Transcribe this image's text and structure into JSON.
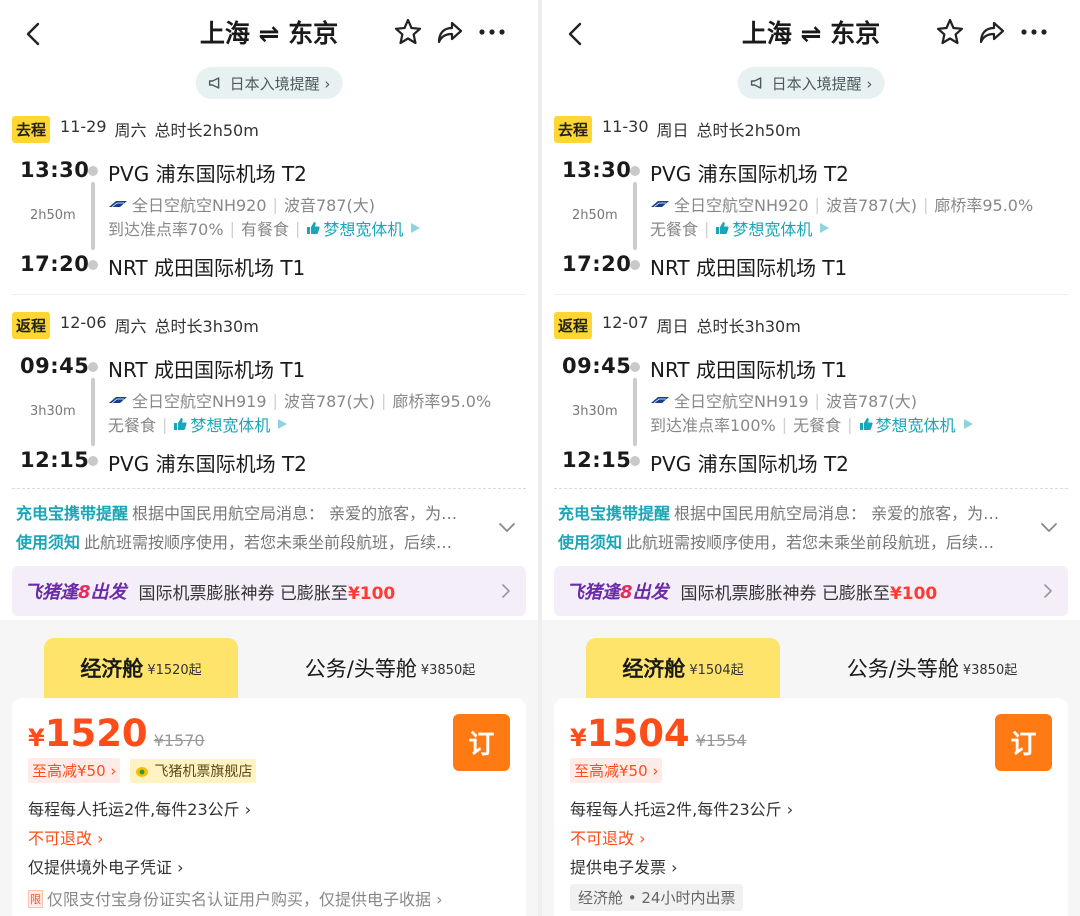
{
  "panels": [
    {
      "header": {
        "title": "上海 ⇌ 东京"
      },
      "notice": "日本入境提醒 ›",
      "outbound": {
        "badge": "去程",
        "date": "11-29",
        "weekday": "周六",
        "total": "总时长2h50m",
        "dep_time": "13:30",
        "dep_airport": "PVG 浦东国际机场 T2",
        "arr_time": "17:20",
        "arr_airport": "NRT 成田国际机场 T1",
        "duration": "2h50m",
        "airline": "全日空航空NH920",
        "aircraft": "波音787(大)",
        "extra1": "",
        "ontime": "到达准点率70%",
        "meal": "有餐食",
        "dream": "梦想宽体机"
      },
      "return": {
        "badge": "返程",
        "date": "12-06",
        "weekday": "周六",
        "total": "总时长3h30m",
        "dep_time": "09:45",
        "dep_airport": "NRT 成田国际机场 T1",
        "arr_time": "12:15",
        "arr_airport": "PVG 浦东国际机场 T2",
        "duration": "3h30m",
        "airline": "全日空航空NH919",
        "aircraft": "波音787(大)",
        "extra1": "廊桥率95.0%",
        "ontime": "",
        "meal": "无餐食",
        "dream": "梦想宽体机"
      },
      "reminders": {
        "r1_title": "充电宝携带提醒",
        "r1_text": "根据中国民用航空局消息： 亲爱的旅客，为…",
        "r2_title": "使用须知",
        "r2_text": "此航班需按顺序使用，若您未乘坐前段航班，后续…"
      },
      "promo": {
        "brand_a": "飞猪逢",
        "brand_b": "8",
        "brand_c": "出发",
        "text": "国际机票膨胀神券 已膨胀至",
        "amount": "¥100"
      },
      "tabs": {
        "econ_name": "经济舱",
        "econ_price": "¥1520起",
        "biz_name": "公务/头等舱",
        "biz_price": "¥3850起"
      },
      "fare": {
        "yen": "¥",
        "price": "1520",
        "orig": "¥1570",
        "book": "订",
        "discount": "至高减¥50 ›",
        "shop": "飞猪机票旗舰店",
        "baggage": "每程每人托运2件,每件23公斤 ›",
        "refund": "不可退改 ›",
        "voucher": "仅提供境外电子凭证 ›",
        "limit_icon": "限",
        "limit": "仅限支付宝身份证实名认证用户购买，仅提供电子收据 ›",
        "ticket_badge": ""
      }
    },
    {
      "header": {
        "title": "上海 ⇌ 东京"
      },
      "notice": "日本入境提醒 ›",
      "outbound": {
        "badge": "去程",
        "date": "11-30",
        "weekday": "周日",
        "total": "总时长2h50m",
        "dep_time": "13:30",
        "dep_airport": "PVG 浦东国际机场 T2",
        "arr_time": "17:20",
        "arr_airport": "NRT 成田国际机场 T1",
        "duration": "2h50m",
        "airline": "全日空航空NH920",
        "aircraft": "波音787(大)",
        "extra1": "廊桥率95.0%",
        "ontime": "",
        "meal": "无餐食",
        "dream": "梦想宽体机"
      },
      "return": {
        "badge": "返程",
        "date": "12-07",
        "weekday": "周日",
        "total": "总时长3h30m",
        "dep_time": "09:45",
        "dep_airport": "NRT 成田国际机场 T1",
        "arr_time": "12:15",
        "arr_airport": "PVG 浦东国际机场 T2",
        "duration": "3h30m",
        "airline": "全日空航空NH919",
        "aircraft": "波音787(大)",
        "extra1": "",
        "ontime": "到达准点率100%",
        "meal": "无餐食",
        "dream": "梦想宽体机"
      },
      "reminders": {
        "r1_title": "充电宝携带提醒",
        "r1_text": "根据中国民用航空局消息： 亲爱的旅客，为…",
        "r2_title": "使用须知",
        "r2_text": "此航班需按顺序使用，若您未乘坐前段航班，后续…"
      },
      "promo": {
        "brand_a": "飞猪逢",
        "brand_b": "8",
        "brand_c": "出发",
        "text": "国际机票膨胀神券 已膨胀至",
        "amount": "¥100"
      },
      "tabs": {
        "econ_name": "经济舱",
        "econ_price": "¥1504起",
        "biz_name": "公务/头等舱",
        "biz_price": "¥3850起"
      },
      "fare": {
        "yen": "¥",
        "price": "1504",
        "orig": "¥1554",
        "book": "订",
        "discount": "至高减¥50 ›",
        "shop": "",
        "baggage": "每程每人托运2件,每件23公斤 ›",
        "refund": "不可退改 ›",
        "voucher": "提供电子发票 ›",
        "limit_icon": "",
        "limit": "",
        "ticket_badge": "经济舱 • 24小时内出票"
      }
    }
  ],
  "colors": {
    "accent_yellow": "#ffd632",
    "price_orange": "#ff4d1a",
    "teal": "#1aa6b8",
    "book_orange": "#ff7a12"
  },
  "icons": [
    "back-icon",
    "star-icon",
    "share-icon",
    "more-icon",
    "megaphone-icon",
    "airline-logo-icon",
    "thumbs-up-icon",
    "play-icon",
    "chevron-down-icon",
    "chevron-right-icon",
    "fliggy-shop-icon"
  ]
}
